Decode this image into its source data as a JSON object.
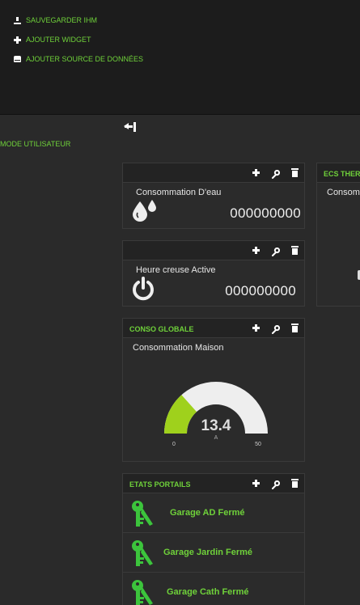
{
  "menu": {
    "save_label": "SAUVEGARDER IHM",
    "add_widget_label": "AJOUTER WIDGET",
    "add_source_label": "AJOUTER SOURCE DE DONNÉES"
  },
  "mode_label": "MODE UTILISATEUR",
  "panes": {
    "water": {
      "title": "",
      "widget_title": "Consommation D'eau",
      "value": "000000000"
    },
    "offpeak": {
      "title": "",
      "widget_title": "Heure creuse Active",
      "value": "000000000"
    },
    "global": {
      "title": "CONSO GLOBALE",
      "widget_title": "Consommation Maison",
      "gauge": {
        "value": 13.4,
        "value_text": "13.4",
        "unit": "A",
        "min": 0,
        "max": 50,
        "min_text": "0",
        "max_text": "50"
      }
    },
    "portals": {
      "title": "ETATS PORTAILS",
      "items": [
        {
          "label": "Garage AD Fermé"
        },
        {
          "label": "Garage Jardin Fermé"
        },
        {
          "label": "Garage Cath Fermé"
        }
      ]
    },
    "ecs": {
      "title": "ECS THER",
      "widget_title": "Consom"
    }
  },
  "colors": {
    "accent": "#6fd13a",
    "gauge_fill": "#9fd11c",
    "gauge_track": "#eeeeee",
    "key_icon": "#3cc43c"
  },
  "icons": [
    "download-icon",
    "plus-icon",
    "database-icon",
    "collapse-icon",
    "wrench-icon",
    "trash-icon",
    "water-drops-icon",
    "power-icon",
    "key-icon"
  ]
}
